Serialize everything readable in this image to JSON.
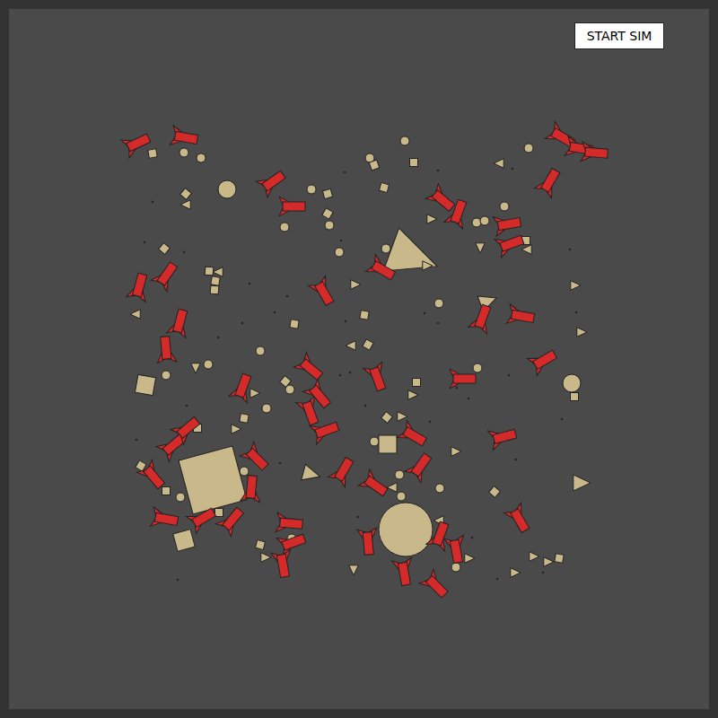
{
  "button": {
    "label": "START SIM"
  }
}
